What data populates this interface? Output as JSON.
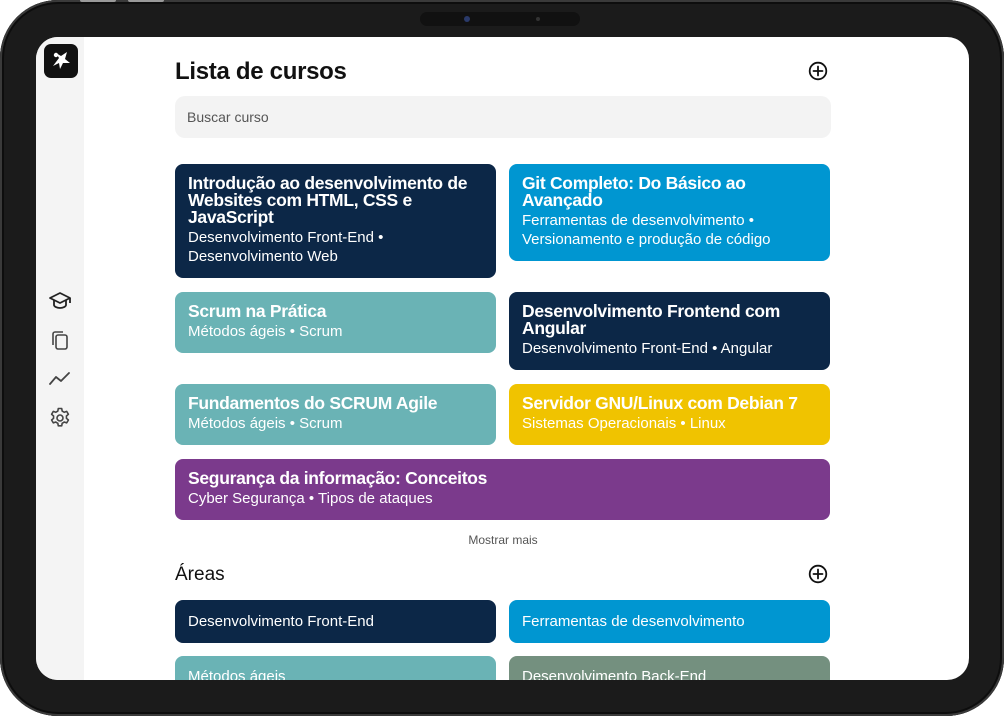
{
  "app": {
    "logo_icon": "app-logo-icon"
  },
  "sidebar": {
    "items": [
      {
        "name": "courses",
        "icon": "graduation-cap-icon"
      },
      {
        "name": "copies",
        "icon": "copy-icon"
      },
      {
        "name": "stats",
        "icon": "trend-line-icon"
      },
      {
        "name": "settings",
        "icon": "gear-icon"
      }
    ]
  },
  "courses_section": {
    "title": "Lista de cursos",
    "add_icon": "plus-circle-icon",
    "search": {
      "placeholder": "Buscar curso",
      "value": ""
    },
    "courses": [
      {
        "title": "Introdução ao desenvolvimento de Websites com HTML, CSS e JavaScript",
        "subtitle": "Desenvolvimento Front-End • Desenvolvimento Web",
        "color": "#0c2747",
        "text_color": "#ffffff"
      },
      {
        "title": "Git Completo: Do Básico ao Avançado",
        "subtitle": "Ferramentas de desenvolvimento • Versionamento e produção de código",
        "color": "#0096d1",
        "text_color": "#ffffff"
      },
      {
        "title": "Scrum na Prática",
        "subtitle": "Métodos ágeis • Scrum",
        "color": "#6ab3b5",
        "text_color": "#ffffff"
      },
      {
        "title": "Desenvolvimento Frontend com Angular",
        "subtitle": "Desenvolvimento Front-End • Angular",
        "color": "#0c2747",
        "text_color": "#ffffff"
      },
      {
        "title": "Fundamentos do SCRUM Agile",
        "subtitle": "Métodos ágeis • Scrum",
        "color": "#6ab3b5",
        "text_color": "#ffffff"
      },
      {
        "title": "Servidor GNU/Linux com Debian 7",
        "subtitle": "Sistemas Operacionais • Linux",
        "color": "#f0c300",
        "text_color": "#ffffff"
      },
      {
        "title": "Segurança da informação: Conceitos",
        "subtitle": "Cyber Segurança • Tipos de ataques",
        "color": "#7b3a8c",
        "text_color": "#ffffff"
      }
    ],
    "show_more": "Mostrar mais"
  },
  "areas_section": {
    "title": "Áreas",
    "add_icon": "plus-circle-icon",
    "areas": [
      {
        "label": "Desenvolvimento Front-End",
        "color": "#0c2747"
      },
      {
        "label": "Ferramentas de desenvolvimento",
        "color": "#0096d1"
      },
      {
        "label": "Métodos ágeis",
        "color": "#6ab3b5"
      },
      {
        "label": "Desenvolvimento Back-End",
        "color": "#74907f"
      }
    ]
  }
}
